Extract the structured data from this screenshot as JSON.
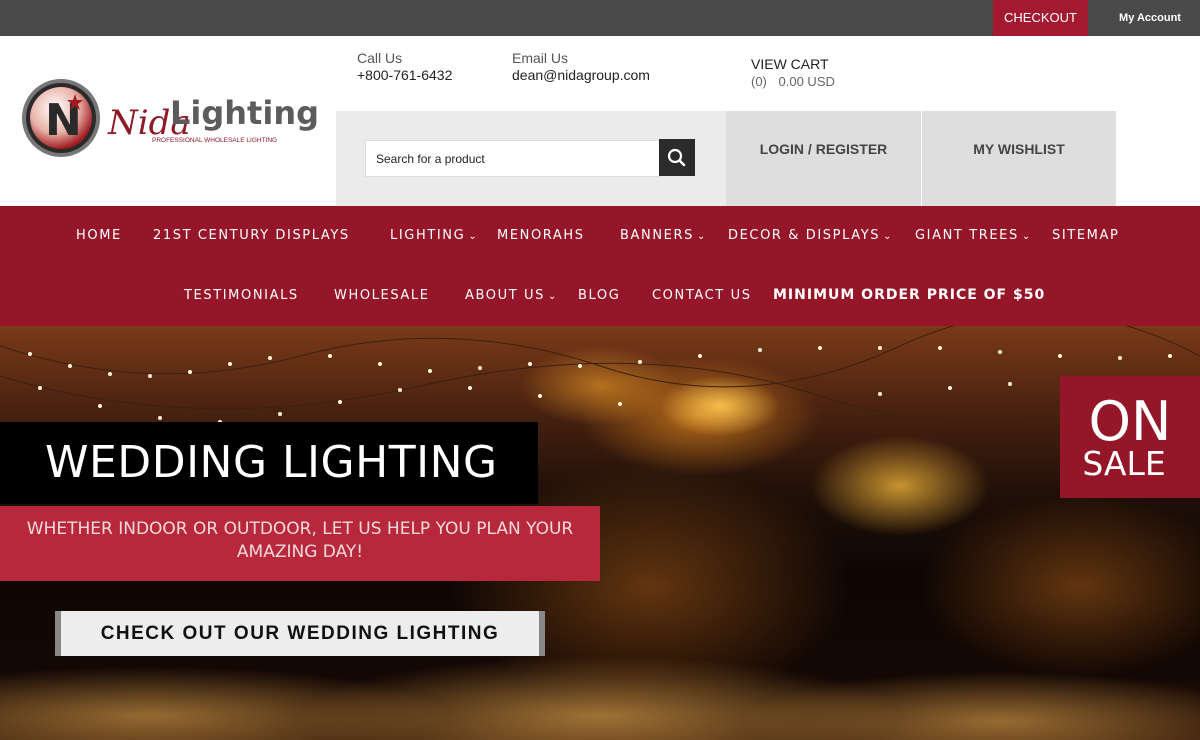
{
  "topbar": {
    "checkout": "CHECKOUT",
    "my_account": "My Account"
  },
  "header": {
    "logo_text": {
      "nida": "Nida",
      "lighting": "Lighting",
      "tagline": "PROFESSIONAL WHOLESALE LIGHTING",
      "badge_letter": "N"
    },
    "call": {
      "label": "Call Us",
      "value": "+800-761-6432"
    },
    "email": {
      "label": "Email Us",
      "value": "dean@nidagroup.com"
    },
    "cart": {
      "label": "VIEW CART",
      "count": "(0)",
      "total": "0.00 USD"
    },
    "search": {
      "placeholder": "Search for a product"
    },
    "login": "LOGIN / REGISTER",
    "wishlist": "MY WISHLIST"
  },
  "nav": {
    "row1": [
      "HOME",
      "21ST CENTURY DISPLAYS",
      "LIGHTING",
      "MENORAHS",
      "BANNERS",
      "DECOR & DISPLAYS",
      "GIANT TREES",
      "SITEMAP"
    ],
    "row2": [
      "TESTIMONIALS",
      "WHOLESALE",
      "ABOUT US",
      "BLOG",
      "CONTACT US"
    ],
    "notice": "MINIMUM ORDER PRICE OF $50"
  },
  "hero": {
    "title": "WEDDING LIGHTING",
    "subtitle": "WHETHER INDOOR OR OUTDOOR, LET US HELP YOU PLAN YOUR AMAZING DAY!",
    "cta": "CHECK OUT OUR WEDDING LIGHTING",
    "badge_on": "ON",
    "badge_sale": "SALE"
  },
  "colors": {
    "brand_red": "#961629",
    "topbar": "#4a4a4a",
    "accent_red": "#b8283d"
  }
}
